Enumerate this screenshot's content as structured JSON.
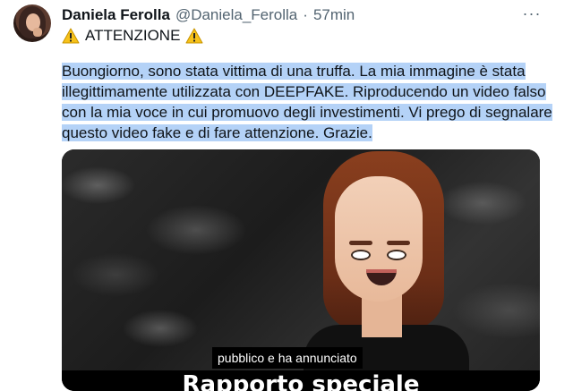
{
  "author": {
    "name": "Daniela Ferolla",
    "handle": "@Daniela_Ferolla",
    "separator": "·",
    "time": "57min"
  },
  "more_label": "···",
  "headline": {
    "text": "ATTENZIONE",
    "left_icon": "warning-icon",
    "right_icon": "warning-icon"
  },
  "body_lines": [
    "Buongiorno, sono stata vittima di una truffa. La mia immagine è stata",
    "illegittimamente utilizzata con DEEPFAKE. Riproducendo un video falso",
    "con la mia voce in cui promuovo degli investimenti. Vi prego di segnalare",
    "questo video fake e di fare attenzione. Grazie."
  ],
  "media": {
    "caption_small": "pubblico e ha annunciato",
    "caption_big": "Rapporto speciale"
  },
  "colors": {
    "selection": "#b4d2f7",
    "secondary_text": "#536471",
    "primary_text": "#0f1419",
    "warning_yellow": "#f7c21a"
  }
}
